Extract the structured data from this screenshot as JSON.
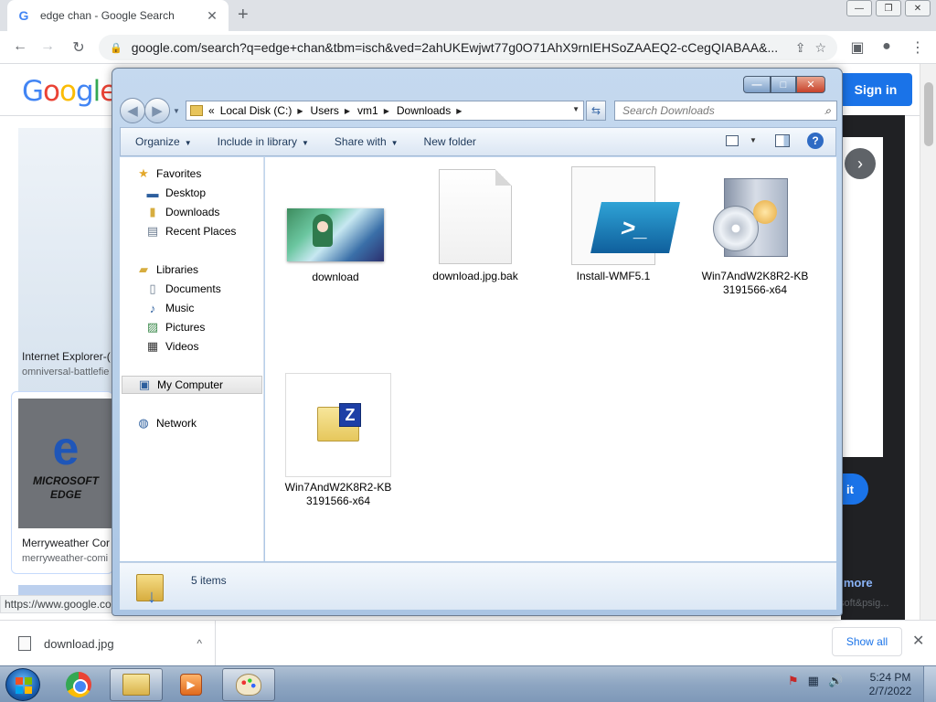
{
  "browser": {
    "tab_title": "edge chan - Google Search",
    "tab_favicon": "G",
    "new_tab": "+",
    "url": "google.com/search?q=edge+chan&tbm=isch&ved=2ahUKEwjwt77g0O71AhX9rnIEHSoZAAEQ2-cCegQIABAA&...",
    "window_minimize": "—",
    "window_restore": "❐",
    "window_close": "✕",
    "nav": {
      "back": "←",
      "forward": "→",
      "reload": "↻"
    },
    "omni_icons": {
      "share": "⇪",
      "star": "☆"
    },
    "toolbar_icons": {
      "sidepanel": "▣",
      "profile": "●",
      "menu": "⋮"
    }
  },
  "google": {
    "logo": [
      "G",
      "o",
      "o",
      "g",
      "l",
      "e"
    ],
    "logo_colors": [
      "#4285f4",
      "#ea4335",
      "#fbbc05",
      "#4285f4",
      "#34a853",
      "#ea4335"
    ],
    "sign_in": "Sign in",
    "result1_caption": "Internet Explorer-(",
    "result1_source": "omniversal-battlefie",
    "result2_logo_e": "e",
    "result2_logo_text": "MICROSOFT EDGE",
    "result2_caption": "Merryweather Cor",
    "result2_source": "merryweather-comi",
    "next_arrow": "›",
    "visit_label": "it",
    "see_more": "e more",
    "status_url": "https://www.google.co",
    "hscroll_text": "soft&psig..."
  },
  "downloads": {
    "item_name": "download.jpg",
    "chevron": "^",
    "show_all": "Show all",
    "close": "✕"
  },
  "explorer": {
    "caption_min": "—",
    "caption_max": "□",
    "caption_close": "✕",
    "nav_back": "◀",
    "nav_forward": "▶",
    "breadcrumb_prefix": "«",
    "breadcrumbs": [
      "Local Disk (C:)",
      "Users",
      "vm1",
      "Downloads"
    ],
    "search_placeholder": "Search Downloads",
    "commands": {
      "organize": "Organize",
      "include_library": "Include in library",
      "share_with": "Share with",
      "new_folder": "New folder"
    },
    "help": "?",
    "nav_pane": {
      "favorites": "Favorites",
      "desktop": "Desktop",
      "downloads": "Downloads",
      "recent_places": "Recent Places",
      "libraries": "Libraries",
      "documents": "Documents",
      "music": "Music",
      "pictures": "Pictures",
      "videos": "Videos",
      "my_computer": "My Computer",
      "network": "Network"
    },
    "files": [
      {
        "name": "download",
        "icon": "image-thumbnail"
      },
      {
        "name": "download.jpg.bak",
        "icon": "blank-file-icon"
      },
      {
        "name": "Install-WMF5.1",
        "icon": "powershell-icon"
      },
      {
        "name": "Win7AndW2K8R2-KB3191566-x64",
        "line1": "Win7AndW2K8R2-KB",
        "line2": "3191566-x64",
        "icon": "installer-box-icon"
      },
      {
        "name": "Win7AndW2K8R2-KB3191566-x64",
        "line1": "Win7AndW2K8R2-KB",
        "line2": "3191566-x64",
        "icon": "zip-folder-icon"
      }
    ],
    "ps_glyph": ">_",
    "zip_glyph": "Z",
    "status": "5 items"
  },
  "taskbar": {
    "time": "5:24 PM",
    "date": "2/7/2022",
    "media_glyph": "▶",
    "tray": {
      "action_center": "⚑",
      "network": "▦",
      "volume": "🔊"
    }
  }
}
